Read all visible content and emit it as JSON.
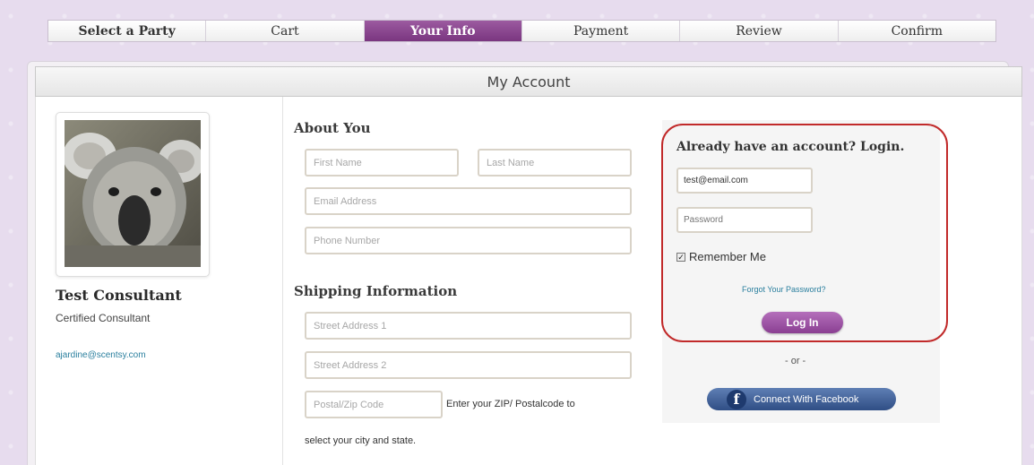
{
  "steps": [
    {
      "label": "Select a Party",
      "active": false
    },
    {
      "label": "Cart",
      "active": false
    },
    {
      "label": "Your Info",
      "active": true
    },
    {
      "label": "Payment",
      "active": false
    },
    {
      "label": "Review",
      "active": false
    },
    {
      "label": "Confirm",
      "active": false
    }
  ],
  "panel": {
    "title": "My Account"
  },
  "consultant": {
    "name": "Test Consultant",
    "title": "Certified Consultant",
    "email": "ajardine@scentsy.com"
  },
  "about": {
    "title": "About You",
    "first_name_placeholder": "First Name",
    "last_name_placeholder": "Last Name",
    "email_placeholder": "Email Address",
    "phone_placeholder": "Phone Number"
  },
  "shipping": {
    "title": "Shipping Information",
    "street1_placeholder": "Street Address 1",
    "street2_placeholder": "Street Address 2",
    "zip_placeholder": "Postal/Zip Code",
    "zip_hint": "Enter your ZIP/ Postalcode to",
    "zip_hint2": "select your city and state."
  },
  "login": {
    "title": "Already have an account? Login.",
    "email_value": "test@email.com",
    "password_placeholder": "Password",
    "remember_label": "Remember Me",
    "remember_checked": true,
    "forgot_label": "Forgot Your Password?",
    "login_button": "Log In",
    "or_text": "- or -",
    "facebook_button": "Connect With Facebook"
  },
  "colors": {
    "accent": "#8a3f92",
    "login_outline": "#c12a2a",
    "facebook": "#2f4e85",
    "link": "#2a7f9e"
  }
}
